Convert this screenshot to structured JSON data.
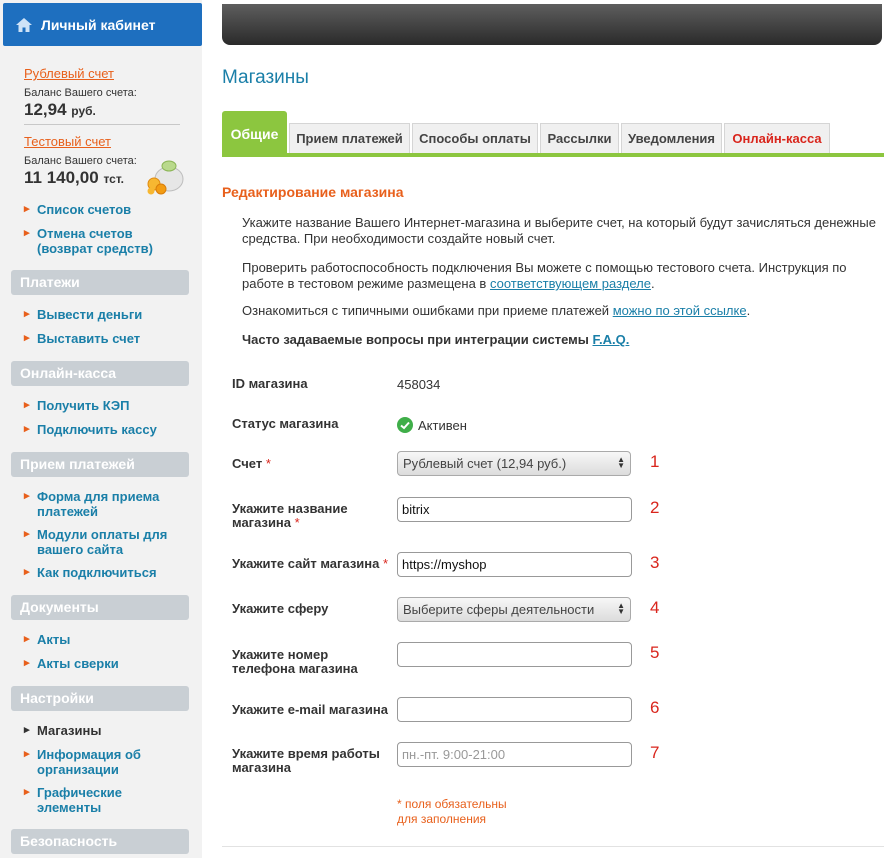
{
  "sidebar": {
    "header": "Личный кабинет",
    "accounts": [
      {
        "link": "Рублевый счет",
        "balance_label": "Баланс Вашего счета:",
        "amount": "12,94",
        "currency": "руб."
      },
      {
        "link": "Тестовый счет",
        "balance_label": "Баланс Вашего счета:",
        "amount": "11 140,00",
        "currency": "тст."
      }
    ],
    "account_links": [
      "Список счетов",
      "Отмена счетов (возврат средств)"
    ],
    "sections": [
      {
        "title": "Платежи",
        "items": [
          "Вывести деньги",
          "Выставить счет"
        ]
      },
      {
        "title": "Онлайн-касса",
        "items": [
          "Получить КЭП",
          "Подключить кассу"
        ]
      },
      {
        "title": "Прием платежей",
        "items": [
          "Форма для приема платежей",
          "Модули оплаты для вашего сайта",
          "Как подключиться"
        ]
      },
      {
        "title": "Документы",
        "items": [
          "Акты",
          "Акты сверки"
        ]
      },
      {
        "title": "Настройки",
        "items": [
          "Магазины",
          "Информация об организации",
          "Графические элементы"
        ]
      },
      {
        "title": "Безопасность",
        "items": []
      }
    ]
  },
  "page": {
    "title": "Магазины",
    "tabs": [
      "Общие",
      "Прием платежей",
      "Способы оплаты",
      "Рассылки",
      "Уведомления",
      "Онлайн-касса"
    ],
    "section_title": "Редактирование магазина",
    "intro1": "Укажите название Вашего Интернет-магазина и выберите счет, на который будут зачисляться денежные средства. При необходимости создайте новый счет.",
    "intro2_a": "Проверить работоспособность подключения Вы можете с помощью тестового счета. Инструкция по работе в тестовом режиме размещена в",
    "intro2_link": "соответствующем разделе",
    "intro3_a": "Ознакомиться с типичными ошибками при приеме платежей",
    "intro3_link": "можно по этой ссылке",
    "faq_text": "Часто задаваемые вопросы при интеграции системы",
    "faq_link": "F.A.Q."
  },
  "form": {
    "shop_id_label": "ID магазина",
    "shop_id": "458034",
    "status_label": "Статус магазина",
    "status": "Активен",
    "account_label": "Счет",
    "account_value": "Рублевый счет (12,94 руб.)",
    "name_label": "Укажите название магазина",
    "name_value": "bitrix",
    "site_label": "Укажите сайт магазина",
    "site_value": "https://myshop",
    "sphere_label": "Укажите сферу",
    "sphere_value": "Выберите сферы деятельности",
    "phone_label": "Укажите номер телефона магазина",
    "phone_value": "",
    "email_label": "Укажите e-mail магазина",
    "email_value": "",
    "hours_label": "Укажите время работы магазина",
    "hours_placeholder": "пн.-пт. 9:00-21:00",
    "required_mark": "*",
    "footnote": "* поля обязательны для заполнения",
    "numbers": [
      "1",
      "2",
      "3",
      "4",
      "5",
      "6",
      "7"
    ]
  },
  "colors": {
    "accent_orange": "#e8601c",
    "link_blue": "#1a7fa8",
    "tab_green": "#8cc63f",
    "header_blue": "#1e6fbf",
    "required_red": "#d9251c"
  }
}
